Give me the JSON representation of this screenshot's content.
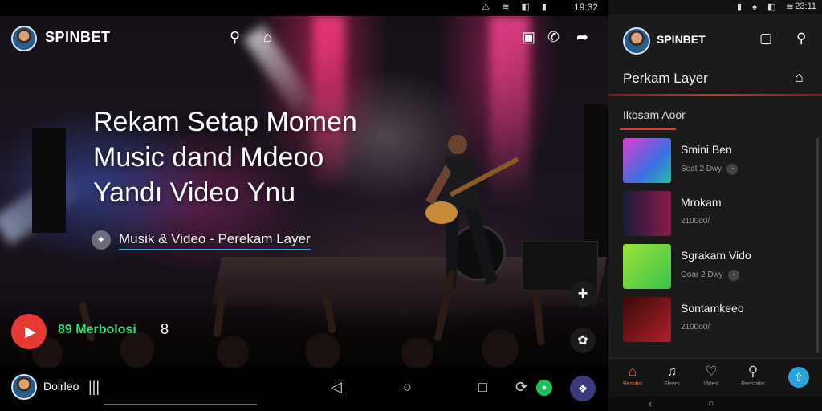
{
  "status_left": {
    "time": "19:32",
    "icons": "⚠ ≋ ◧ ▮"
  },
  "status_right": {
    "time": "23:11",
    "icons": "▮ ♠ ◧ ≋"
  },
  "brand": "SPINBET",
  "hero": {
    "line1": "Rekam Setap Momen",
    "line2": "Music dand Mdeoo",
    "line3": "Yandı Videο Ynu",
    "subtitle": "Musik & Video - Perekam Layer"
  },
  "player": {
    "members": "89 Merbolosi",
    "count": "8"
  },
  "bottom_user": "Doirleo",
  "right_panel": {
    "section_title": "Perkam Layer",
    "sub_title": "Ikosam Aoor",
    "items": [
      {
        "title": "Smini Ben",
        "meta": "Soat 2 Dwy"
      },
      {
        "title": "Mrokam",
        "meta": "2100o0/"
      },
      {
        "title": "Sgrakam Vido",
        "meta": "Ooar 2 Dwy"
      },
      {
        "title": "Sontamkeeo",
        "meta": "2100o0/"
      }
    ],
    "nav": [
      {
        "label": "Bestaro",
        "icon": "home-icon"
      },
      {
        "label": "Fleers",
        "icon": "music-icon"
      },
      {
        "label": "Vktesl",
        "icon": "heart-icon"
      },
      {
        "label": "Renstabs",
        "icon": "search-icon"
      }
    ]
  },
  "colors": {
    "accent_red": "#e53935",
    "accent_green": "#19c35a",
    "accent_blue": "#2aa3d8",
    "nav_active": "#ff6a3d"
  }
}
